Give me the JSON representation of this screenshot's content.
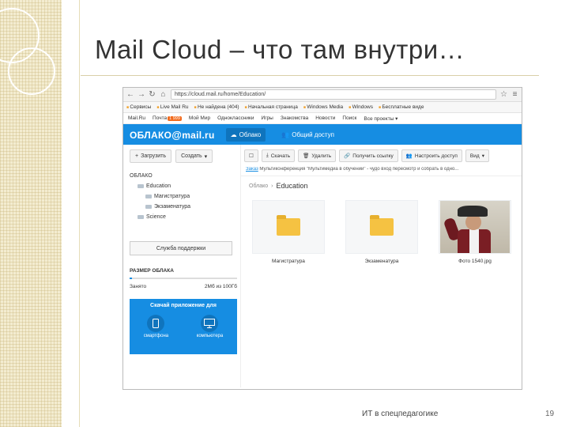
{
  "slide": {
    "title": "Mail Cloud – что там внутри…",
    "footer": "ИТ в спецпедагогике",
    "page_number": "19"
  },
  "browser": {
    "nav_icons": [
      "arrow-left-icon",
      "arrow-right-icon",
      "reload-icon",
      "home-icon"
    ],
    "url": "https://cloud.mail.ru/home/Education/",
    "bookmarks": [
      "Сервисы",
      "Live Mail Ru",
      "Не найдена (404)",
      "Начальная страница",
      "Windows Media",
      "Windows",
      "Бесплатные виде"
    ]
  },
  "portal_nav": {
    "items": [
      "Mail.Ru",
      "Почта",
      "Мой Мир",
      "Одноклассники",
      "Игры",
      "Знакомства",
      "Новости",
      "Поиск",
      "Все проекты ▾"
    ],
    "mail_badge": "1 999"
  },
  "cloud_header": {
    "logo_text": "ОБЛАКО",
    "logo_at": "@",
    "logo_domain": "mail.ru",
    "tabs": [
      "Облако",
      "Общий доступ"
    ]
  },
  "sidebar": {
    "upload_button": "Загрузить",
    "create_button": "Создать",
    "tree_root": "ОБЛАКО",
    "tree": [
      {
        "label": "Education",
        "level": 1
      },
      {
        "label": "Магистратура",
        "level": 2
      },
      {
        "label": "Экзаменатура",
        "level": 2
      },
      {
        "label": "Science",
        "level": 1
      }
    ],
    "support_button": "Служба поддержки",
    "quota_title": "РАЗМЕР ОБЛАКА",
    "quota_used_label": "Занято",
    "quota_value": "2Мб из 100Гб",
    "quota_fill_fraction": 0.02,
    "promo_title": "Скачай приложение для",
    "promo_devices": [
      "смартфона",
      "компьютера"
    ]
  },
  "toolbar": {
    "buttons": [
      "Скачать",
      "Удалить",
      "Получить ссылку",
      "Настроить доступ",
      "Вид"
    ]
  },
  "path_line": {
    "prefix": "Заказ",
    "text": "Мультиконференция \"Мультимедиа в обучении\" - чудо вход пересмотр и собрать в одно..."
  },
  "breadcrumbs": {
    "root": "Облако",
    "current": "Education"
  },
  "files": [
    {
      "name": "Магистратура",
      "type": "folder"
    },
    {
      "name": "Экзаменатура",
      "type": "folder"
    },
    {
      "name": "Фото 1540.jpg",
      "type": "photo"
    }
  ],
  "colors": {
    "brand_blue": "#168de2",
    "folder_yellow": "#f5c242",
    "badge_orange": "#f26b1d"
  }
}
